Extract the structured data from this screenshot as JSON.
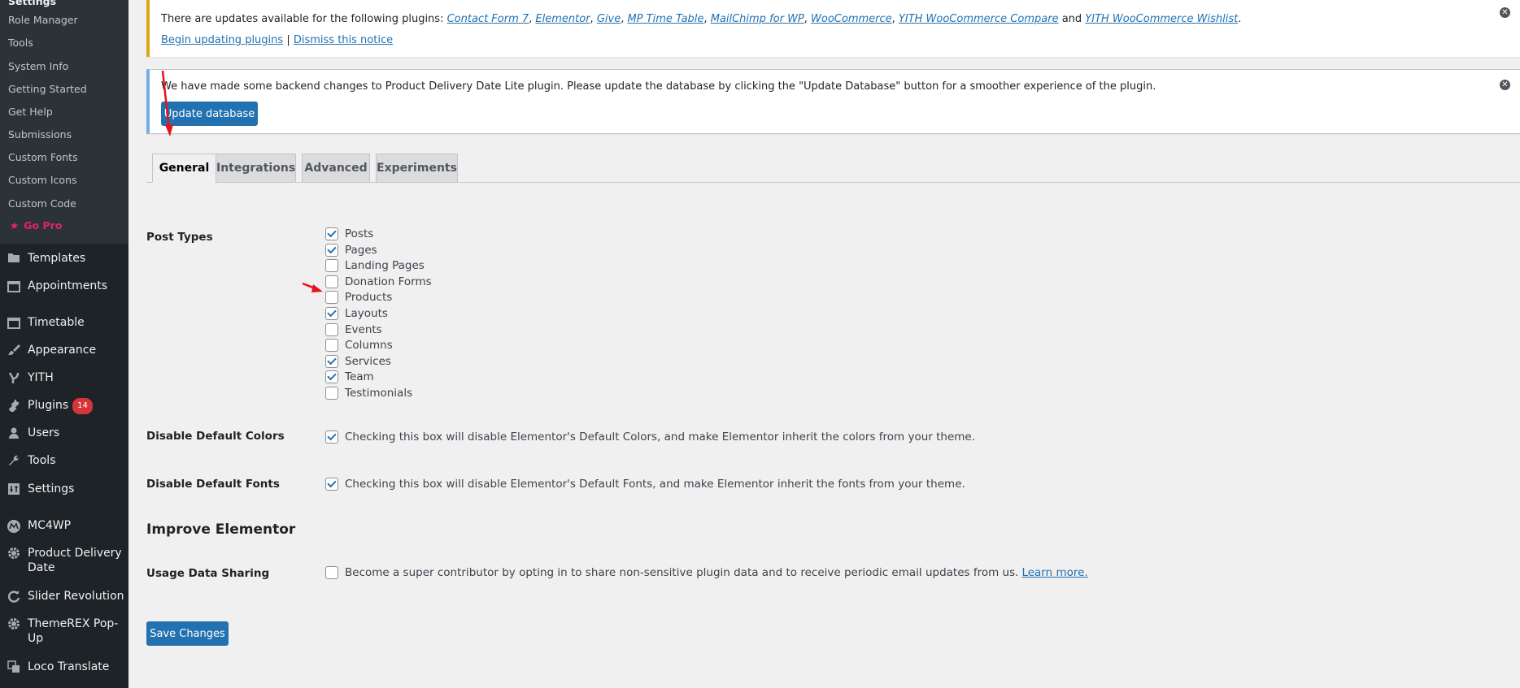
{
  "sidebar": {
    "submenu_top": "Settings",
    "submenu": [
      "Role Manager",
      "Tools",
      "System Info",
      "Getting Started",
      "Get Help",
      "Submissions",
      "Custom Fonts",
      "Custom Icons",
      "Custom Code"
    ],
    "go_pro": "Go Pro",
    "menu": [
      {
        "label": "Templates",
        "icon": "folder-icon"
      },
      {
        "label": "Appointments",
        "icon": "calendar-icon"
      },
      {
        "label": "Timetable",
        "icon": "calendar-icon"
      },
      {
        "label": "Appearance",
        "icon": "brush-icon"
      },
      {
        "label": "YITH",
        "icon": "yith-icon"
      },
      {
        "label": "Plugins",
        "icon": "plug-icon",
        "badge": "14"
      },
      {
        "label": "Users",
        "icon": "user-icon"
      },
      {
        "label": "Tools",
        "icon": "wrench-icon"
      },
      {
        "label": "Settings",
        "icon": "settings-icon"
      },
      {
        "label": "MC4WP",
        "icon": "mc4wp-icon"
      },
      {
        "label": "Product Delivery Date",
        "icon": "gear-icon"
      },
      {
        "label": "Slider Revolution",
        "icon": "refresh-icon"
      },
      {
        "label": "ThemeREX Pop-Up",
        "icon": "gear-icon"
      },
      {
        "label": "Loco Translate",
        "icon": "translate-icon"
      }
    ]
  },
  "notice_updates": {
    "text": "There are updates available for the following plugins:",
    "plugins": [
      "Contact Form 7",
      "Elementor",
      "Give",
      "MP Time Table",
      "MailChimp for WP",
      "WooCommerce",
      "YITH WooCommerce Compare"
    ],
    "and": "and",
    "last_plugin": "YITH WooCommerce Wishlist",
    "period": ".",
    "begin_link": "Begin updating plugins",
    "separator": "|",
    "dismiss_link": "Dismiss this notice"
  },
  "notice_db": {
    "text": "We have made some backend changes to Product Delivery Date Lite plugin. Please update the database by clicking the \"Update Database\" button for a smoother experience of the plugin.",
    "button": "Update database"
  },
  "tabs": [
    "General",
    "Integrations",
    "Advanced",
    "Experiments"
  ],
  "form": {
    "post_types_label": "Post Types",
    "post_types": [
      {
        "label": "Posts",
        "checked": true
      },
      {
        "label": "Pages",
        "checked": true
      },
      {
        "label": "Landing Pages",
        "checked": false
      },
      {
        "label": "Donation Forms",
        "checked": false
      },
      {
        "label": "Products",
        "checked": false
      },
      {
        "label": "Layouts",
        "checked": true
      },
      {
        "label": "Events",
        "checked": false
      },
      {
        "label": "Columns",
        "checked": false
      },
      {
        "label": "Services",
        "checked": true
      },
      {
        "label": "Team",
        "checked": true
      },
      {
        "label": "Testimonials",
        "checked": false
      }
    ],
    "disable_colors_label": "Disable Default Colors",
    "disable_colors_text": "Checking this box will disable Elementor's Default Colors, and make Elementor inherit the colors from your theme.",
    "disable_fonts_label": "Disable Default Fonts",
    "disable_fonts_text": "Checking this box will disable Elementor's Default Fonts, and make Elementor inherit the fonts from your theme.",
    "improve_title": "Improve Elementor",
    "usage_label": "Usage Data Sharing",
    "usage_text": "Become a super contributor by opting in to share non-sensitive plugin data and to receive periodic email updates from us.",
    "learn_more": "Learn more.",
    "save_button": "Save Changes"
  },
  "colors": {
    "accent": "#2271b1",
    "sidebar": "#1d2327",
    "go_pro": "#e2246e",
    "warning": "#dba617",
    "info": "#72aee6",
    "annotation_arrow": "#e8121a"
  }
}
